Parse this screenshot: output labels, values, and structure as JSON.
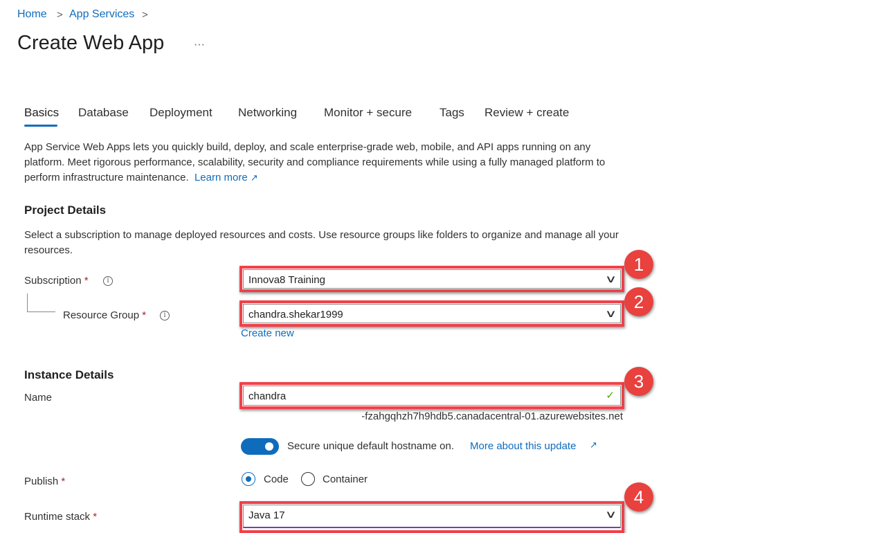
{
  "breadcrumb": {
    "items": [
      "Home",
      "App Services"
    ],
    "separator": ">"
  },
  "page": {
    "title": "Create Web App",
    "more": "···"
  },
  "tabs": [
    {
      "label": "Basics",
      "active": true
    },
    {
      "label": "Database"
    },
    {
      "label": "Deployment"
    },
    {
      "label": "Networking"
    },
    {
      "label": "Monitor + secure"
    },
    {
      "label": "Tags"
    },
    {
      "label": "Review + create"
    }
  ],
  "intro": {
    "text": "App Service Web Apps lets you quickly build, deploy, and scale enterprise-grade web, mobile, and API apps running on any platform. Meet rigorous performance, scalability, security and compliance requirements while using a fully managed platform to perform infrastructure maintenance.",
    "learn_more": "Learn more"
  },
  "project": {
    "heading": "Project Details",
    "description": "Select a subscription to manage deployed resources and costs. Use resource groups like folders to organize and manage all your resources.",
    "subscription": {
      "label": "Subscription",
      "value": "Innova8 Training"
    },
    "resource_group": {
      "label": "Resource Group",
      "value": "chandra.shekar1999",
      "create_new": "Create new"
    }
  },
  "instance": {
    "heading": "Instance Details",
    "name": {
      "label": "Name",
      "value": "chandra",
      "suffix": "-fzahgqhzh7h9hdb5.canadacentral-01.azurewebsites.net"
    },
    "secure_hostname": {
      "on": true,
      "text": "Secure unique default hostname on.",
      "link": "More about this update"
    },
    "publish": {
      "label": "Publish",
      "options": [
        "Code",
        "Container"
      ],
      "selected": "Code"
    },
    "runtime": {
      "label": "Runtime stack",
      "value": "Java 17"
    }
  },
  "annotations": [
    "1",
    "2",
    "3",
    "4"
  ],
  "colors": {
    "accent": "#0f6cbd",
    "highlight": "#f0414a",
    "badge": "#e8413e",
    "valid": "#57a300"
  },
  "required_mark": "*",
  "info_glyph": "i",
  "chevron": "∨",
  "check": "✓",
  "external": "↗"
}
